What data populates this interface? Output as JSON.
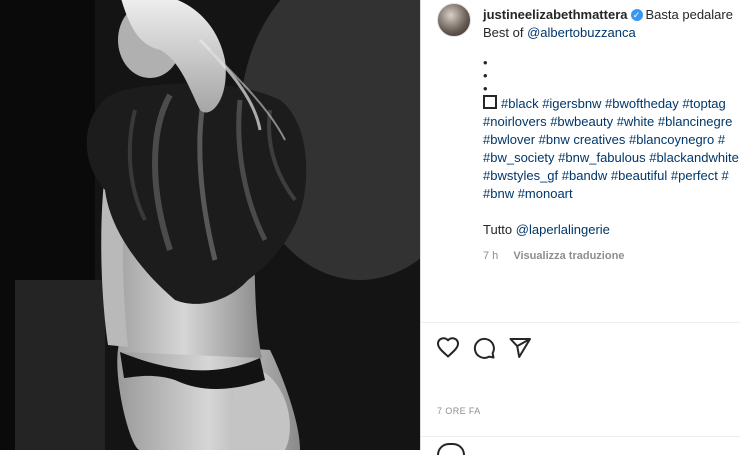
{
  "post": {
    "username": "justineelizabethmattera",
    "verified_mark": "✓",
    "caption_text": "Basta pedalare",
    "credit_prefix": "Best of",
    "credit_handle": "@albertobuzzanca",
    "dots": [
      "•",
      "•",
      "•"
    ],
    "hashtag_lines": [
      "#black #igersbnw #bwoftheday #toptag",
      "#noirlovers #bwbeauty #white #blancinegre",
      "#bwlover #bnw creatives #blancoynegro #",
      "#bw_society #bnw_fabulous #blackandwhite",
      "#bwstyles_gf #bandw #beautiful #perfect #",
      "#bnw #monoart"
    ],
    "tutto_prefix": "Tutto",
    "tutto_handle": "@laperlalingerie",
    "time_ago": "7 h",
    "translate_label": "Visualizza traduzione",
    "posted_time": "7 ORE FA"
  },
  "icons": {
    "like": "heart-icon",
    "comment": "comment-icon",
    "share": "paper-plane-icon",
    "caption_square": "square-icon"
  },
  "colors": {
    "link": "#00376b",
    "muted": "#8e8e8e",
    "verified": "#3897f0"
  }
}
